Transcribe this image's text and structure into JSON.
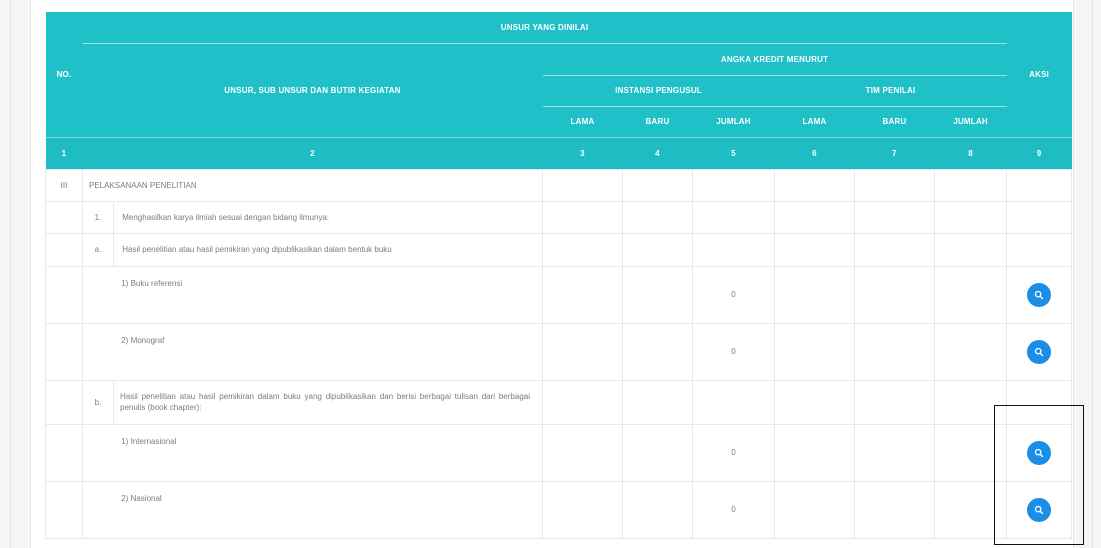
{
  "table": {
    "header": {
      "no": "NO.",
      "unsur_dinilai": "UNSUR YANG DINILAI",
      "unsur_sub": "UNSUR, SUB UNSUR DAN BUTIR KEGIATAN",
      "angka_kredit": "ANGKA KREDIT MENURUT",
      "instansi": "INSTANSI PENGUSUL",
      "tim_penilai": "TIM PENILAI",
      "aksi": "AKSI",
      "lama": "LAMA",
      "baru": "BARU",
      "jumlah": "JUMLAH"
    },
    "column_numbers": [
      "1",
      "2",
      "3",
      "4",
      "5",
      "6",
      "7",
      "8",
      "9"
    ],
    "rows": {
      "section_no": "III",
      "section_title": "PELAKSANAAN PENELITIAN",
      "item1_no": "1.",
      "item1_text": "Menghasilkan karya ilmiah sesuai dengan bidang ilmunya:",
      "item_a_no": "a.",
      "item_a_text": "Hasil penelitian atau hasil pemikiran yang dipublikasikan dalam bentuk buku",
      "item_a1_text": "1) Buku referensi",
      "item_a1_total": "0",
      "item_a2_text": "2) Monograf",
      "item_a2_total": "0",
      "item_b_no": "b.",
      "item_b_text": "Hasil penelitian atau hasil pemikiran dalam buku yang dipublikasikan dan berisi berbagai tulisan dari berbagai penulis (book chapter):",
      "item_b1_text": "1) Internasional",
      "item_b1_total": "0",
      "item_b2_text": "2) Nasional",
      "item_b2_total": "0"
    }
  },
  "colors": {
    "header_bg": "#20c0c8",
    "action_button": "#1c8ee6"
  },
  "icons": {
    "action": "search-icon"
  }
}
